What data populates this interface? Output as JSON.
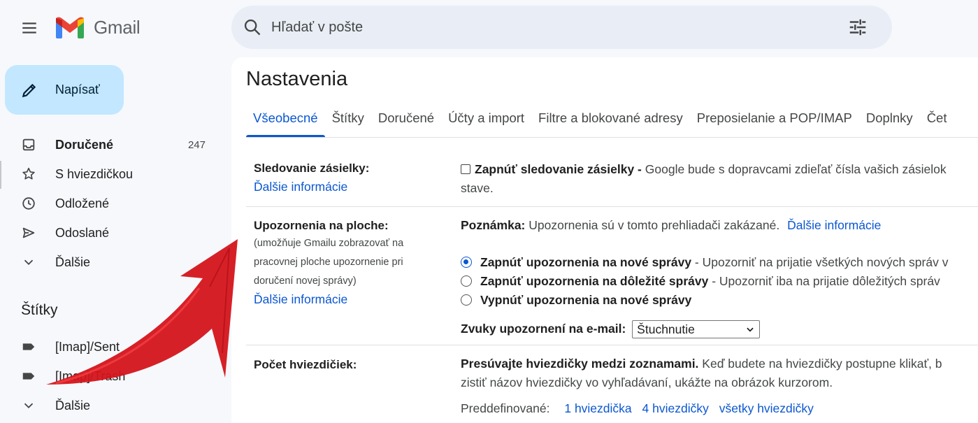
{
  "app": {
    "name": "Gmail",
    "search_placeholder": "Hľadať v pošte"
  },
  "sidebar": {
    "compose_label": "Napísať",
    "items": [
      {
        "label": "Doručené",
        "count": "247",
        "icon": "inbox-icon"
      },
      {
        "label": "S hviezdičkou",
        "icon": "star-icon"
      },
      {
        "label": "Odložené",
        "icon": "clock-icon"
      },
      {
        "label": "Odoslané",
        "icon": "send-icon"
      },
      {
        "label": "Ďalšie",
        "icon": "chevron-down-icon"
      }
    ],
    "labels_heading": "Štítky",
    "labels": [
      {
        "label": "[Imap]/Sent",
        "icon": "label-icon"
      },
      {
        "label": "[Imap]/Trash",
        "icon": "label-icon"
      },
      {
        "label": "Ďalšie",
        "icon": "chevron-down-icon"
      }
    ]
  },
  "settings": {
    "title": "Nastavenia",
    "tabs": [
      "Všeobecné",
      "Štítky",
      "Doručené",
      "Účty a import",
      "Filtre a blokované adresy",
      "Preposielanie a POP/IMAP",
      "Doplnky",
      "Čet"
    ],
    "active_tab": "Všeobecné",
    "package_tracking": {
      "label": "Sledovanie zásielky:",
      "more": "Ďalšie informácie",
      "checkbox_title": "Zapnúť sledovanie zásielky -",
      "checkbox_desc": " Google bude s dopravcami zdieľať čísla vašich zásielok",
      "desc_line2": "stave.",
      "checked": false
    },
    "desktop_notifications": {
      "label": "Upozornenia na ploche:",
      "sub1": "(umožňuje Gmailu zobrazovať na",
      "sub2": "pracovnej ploche upozornenie pri",
      "sub3": "doručení novej správy)",
      "more": "Ďalšie informácie",
      "note_label": "Poznámka:",
      "note_text": " Upozornenia sú v tomto prehliadači zakázané.",
      "note_link": "Ďalšie informácie",
      "options": [
        {
          "title": "Zapnúť upozornenia na nové správy",
          "desc": " - Upozorniť na prijatie všetkých nových správ v",
          "selected": true
        },
        {
          "title": "Zapnúť upozornenia na dôležité správy",
          "desc": " - Upozorniť iba na prijatie dôležitých správ",
          "selected": false
        },
        {
          "title": "Vypnúť upozornenia na nové správy",
          "desc": "",
          "selected": false
        }
      ],
      "sound_label": "Zvuky upozornení na e-mail:",
      "sound_value": "Štuchnutie"
    },
    "stars": {
      "label": "Počet hviezdičiek:",
      "title": "Presúvajte hviezdičky medzi zoznamami.",
      "desc1": "  Keď budete na hviezdičky postupne klikať, b",
      "desc2": "zistiť názov hviezdičky vo vyhľadávaní, ukážte na obrázok kurzorom.",
      "presets_label": "Preddefinované:",
      "presets": [
        "1 hviezdička",
        "4 hviezdičky",
        "všetky hviezdičky"
      ]
    }
  },
  "colors": {
    "accent": "#0b57d0",
    "compose_bg": "#c2e7ff",
    "annotation_arrow": "#d4141b"
  }
}
